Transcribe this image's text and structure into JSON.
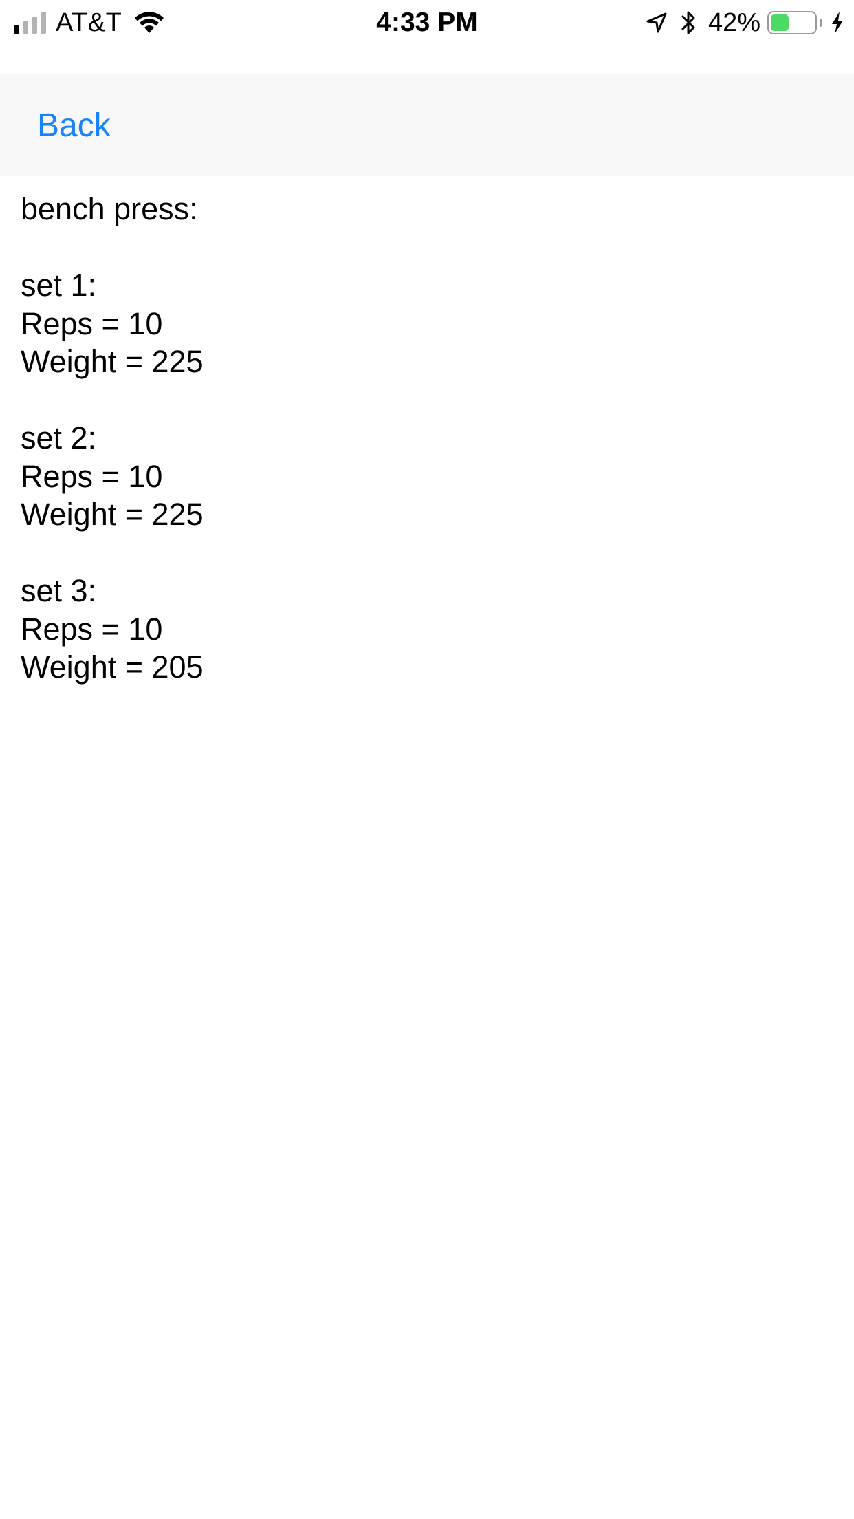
{
  "status_bar": {
    "carrier": "AT&T",
    "time": "4:33 PM",
    "battery_percent_label": "42%",
    "battery_level": 0.42,
    "battery_color": "#4cd964",
    "signal_bars_active": 1,
    "signal_bars_total": 4,
    "icons": [
      "signal-icon",
      "wifi-icon",
      "location-arrow-icon",
      "bluetooth-icon",
      "battery-icon",
      "charging-bolt-icon"
    ]
  },
  "nav": {
    "back_label": "Back",
    "accent_color": "#1a82fb"
  },
  "workout": {
    "title": "bench press:",
    "sets": [
      {
        "label": "set 1:",
        "reps": "Reps = 10",
        "weight": "Weight = 225"
      },
      {
        "label": "set 2:",
        "reps": "Reps = 10",
        "weight": "Weight = 225"
      },
      {
        "label": "set 3:",
        "reps": "Reps = 10",
        "weight": "Weight = 205"
      }
    ]
  }
}
